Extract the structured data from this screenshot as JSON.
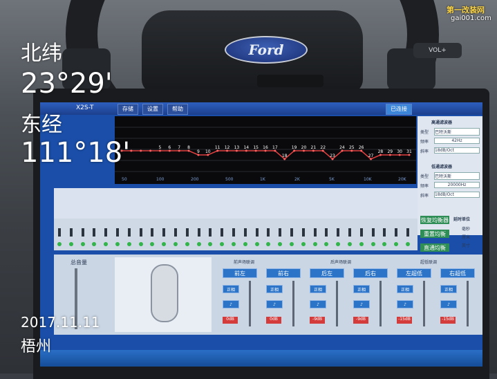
{
  "overlay": {
    "latitude_label": "北纬",
    "latitude_value": "23°29'",
    "longitude_label": "东经",
    "longitude_value": "111°18'",
    "date": "2017.11.11",
    "city": "梧州"
  },
  "watermark": {
    "line1": "第一改装网",
    "line2": "gai001.com"
  },
  "car": {
    "brand_badge": "Ford",
    "button_label": "VOL+"
  },
  "app": {
    "title": "X2S-T",
    "menu": [
      "存储",
      "设置",
      "帮助"
    ],
    "status": "已连接",
    "eq_values": [
      "5",
      "6",
      "7",
      "8",
      "9",
      "10",
      "11",
      "12",
      "13",
      "14",
      "15",
      "16",
      "17",
      "18",
      "19",
      "20",
      "21",
      "22",
      "23",
      "24",
      "25",
      "26",
      "27",
      "28",
      "29",
      "30",
      "31"
    ],
    "eq_freq_labels": [
      "50",
      "100",
      "200",
      "500",
      "1K",
      "2K",
      "5K",
      "10K",
      "20K"
    ],
    "highpass_title": "高通滤波器",
    "highpass": {
      "type_label": "类型",
      "type_value": "巴特沃斯",
      "freq_label": "频率",
      "freq_value": "42Hz",
      "slope_label": "斜率",
      "slope_value": "18dB/Oct"
    },
    "lowpass_title": "低通滤波器",
    "lowpass": {
      "type_label": "类型",
      "type_value": "巴特沃斯",
      "freq_label": "频率",
      "freq_value": "20000Hz",
      "slope_label": "斜率",
      "slope_value": "18dB/Oct"
    },
    "right_buttons": [
      "恢复均衡器",
      "重置均衡",
      "直通均衡"
    ],
    "delay_title": "延时单位",
    "delay_units": [
      "毫秒",
      "厘米",
      "英寸"
    ],
    "master_volume": "总音量",
    "links": [
      "前声场联调",
      "后声场联调",
      "超低联调"
    ],
    "channels": [
      "前左",
      "前右",
      "后左",
      "后右",
      "左超低",
      "右超低"
    ],
    "ch_button": "正相",
    "ch_level": [
      "0dB",
      "0dB",
      "-9dB",
      "-9dB",
      "-15dB",
      "-15dB"
    ]
  },
  "chart_data": {
    "type": "line",
    "x": [
      1,
      2,
      3,
      4,
      5,
      6,
      7,
      8,
      9,
      10,
      11,
      12,
      13,
      14,
      15,
      16,
      17,
      18,
      19,
      20,
      21,
      22,
      23,
      24,
      25,
      26,
      27,
      28,
      29,
      30,
      31
    ],
    "values": [
      0,
      0,
      0,
      0,
      0,
      0,
      0,
      0,
      -1,
      -1,
      0,
      0,
      0,
      0,
      0,
      0,
      0,
      -2,
      0,
      0,
      0,
      0,
      -2,
      0,
      0,
      0,
      -2,
      -1,
      -1,
      -1,
      -1
    ]
  },
  "colors": {
    "eq_line": "#e04040",
    "screen_bg": "#1a4ea8",
    "eq_bg": "#0a0a0c"
  }
}
